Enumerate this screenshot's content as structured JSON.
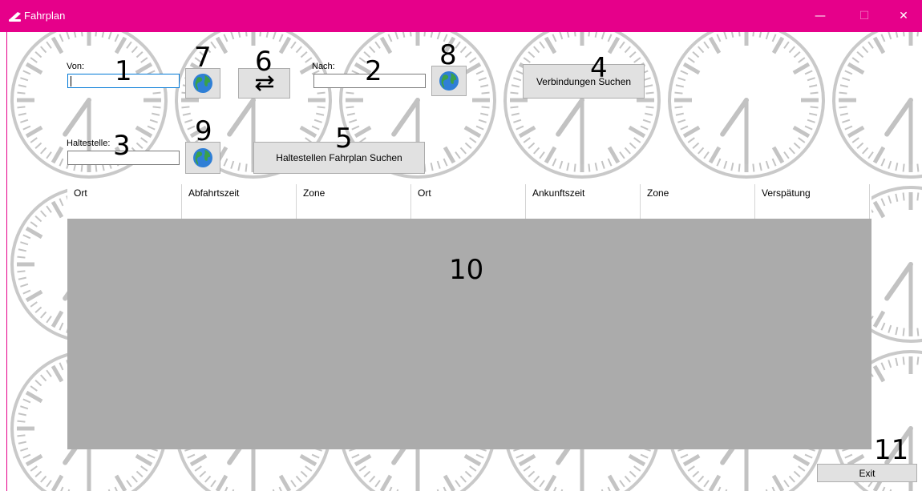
{
  "window": {
    "title": "Fahrplan",
    "minimize_glyph": "—",
    "maximize_glyph": "☐",
    "close_glyph": "✕",
    "titlebar_color": "#e6008a"
  },
  "labels": {
    "von": "Von:",
    "nach": "Nach:",
    "haltestelle": "Haltestelle:"
  },
  "inputs": {
    "von_value": "",
    "nach_value": "",
    "haltestelle_value": ""
  },
  "buttons": {
    "verbindungen": "Verbindungen Suchen",
    "haltestellen_fahrplan": "Haltestellen Fahrplan Suchen",
    "swap_icon": "swap-arrows-icon",
    "globe_icon": "globe-icon",
    "exit": "Exit"
  },
  "annotations": [
    "1",
    "2",
    "3",
    "4",
    "5",
    "6",
    "7",
    "8",
    "9",
    "10",
    "11"
  ],
  "table": {
    "columns": [
      "Ort",
      "Abfahrtszeit",
      "Zone",
      "Ort",
      "Ankunftszeit",
      "Zone",
      "Verspätung"
    ],
    "rows": [
      [
        "",
        "",
        "",
        "",
        "",
        "",
        ""
      ]
    ]
  }
}
